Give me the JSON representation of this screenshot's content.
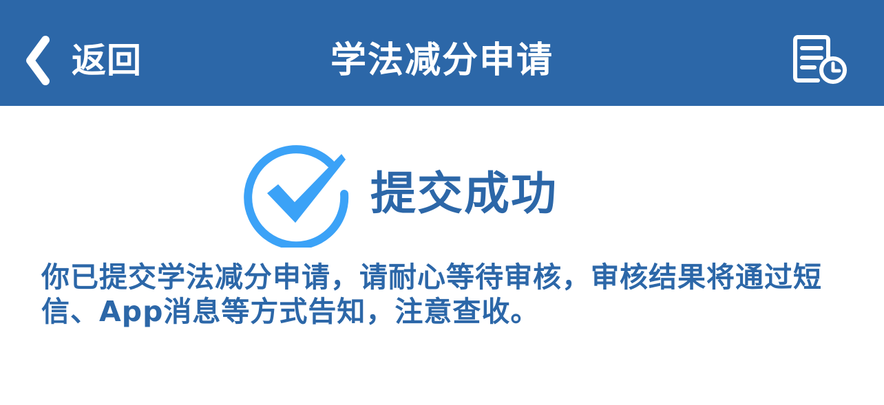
{
  "header": {
    "back_label": "返回",
    "title": "学法减分申请",
    "back_icon": "chevron-left-icon",
    "record_icon": "document-clock-icon"
  },
  "status": {
    "icon": "check-circle-icon",
    "title": "提交成功"
  },
  "message": {
    "text": "你已提交学法减分申请，请耐心等待审核，审核结果将通过短信、App消息等方式告知，注意查收。"
  },
  "colors": {
    "brand": "#2c67a8",
    "accent": "#3ba2f7",
    "background": "#ffffff"
  }
}
